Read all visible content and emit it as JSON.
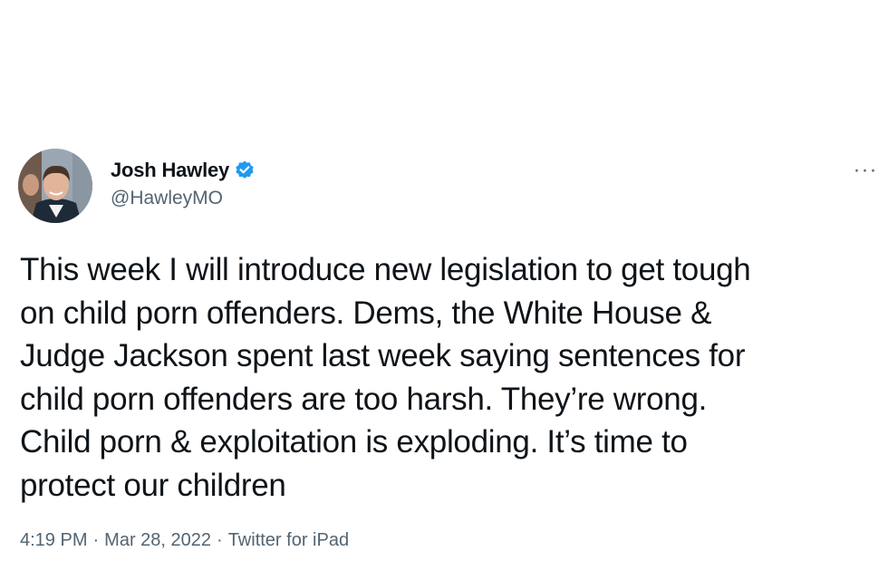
{
  "tweet": {
    "author": {
      "display_name": "Josh Hawley",
      "handle": "@HawleyMO",
      "verified_icon": "verified-badge-icon",
      "avatar": "profile-photo"
    },
    "more_icon": "more-options-icon",
    "more_glyph": "···",
    "text": "This week I will introduce new legislation to get tough\non child porn offenders. Dems, the White House &\nJudge Jackson spent last week saying sentences for\nchild porn offenders are too harsh. They’re wrong.\nChild porn & exploitation is exploding. It’s time to\nprotect our children",
    "timestamp_time": "4:19 PM",
    "timestamp_date": "Mar 28, 2022",
    "separator": "·",
    "source": "Twitter for iPad"
  },
  "colors": {
    "verified_blue": "#1d9bf0",
    "secondary_text": "#536471",
    "primary_text": "#0f1419"
  }
}
